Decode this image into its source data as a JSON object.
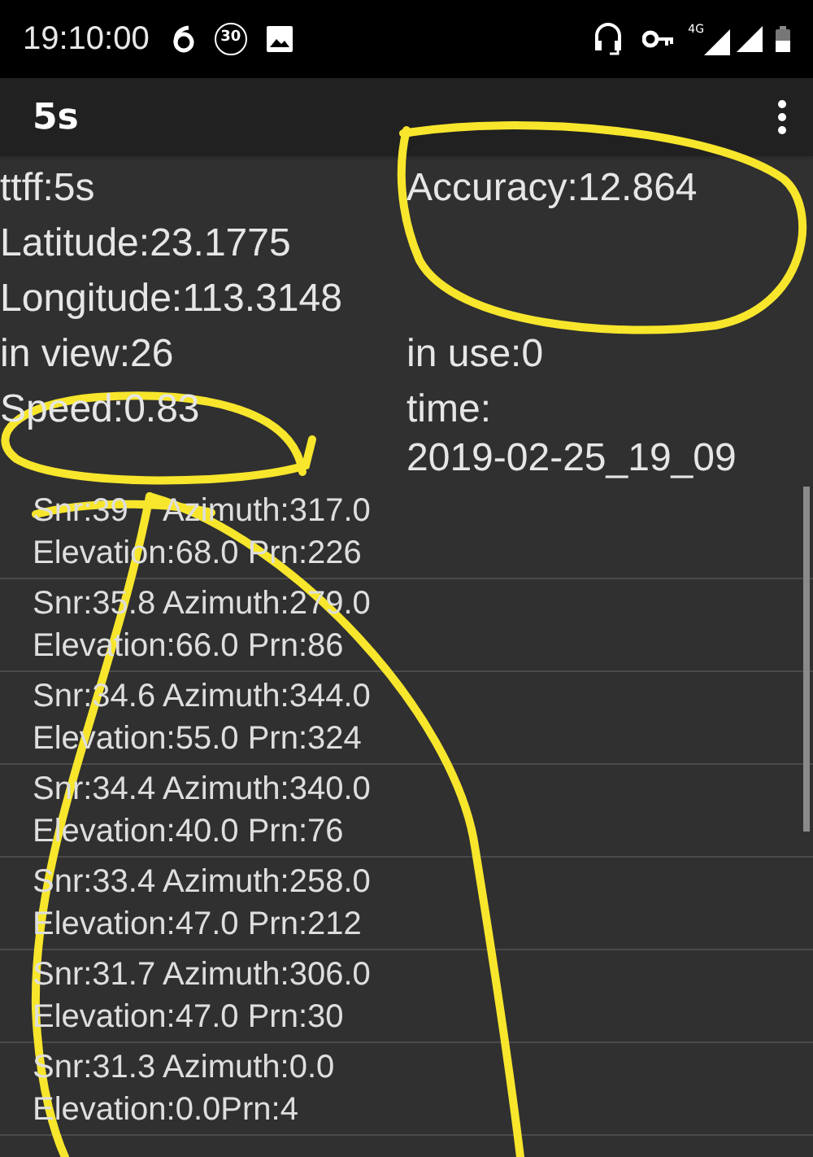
{
  "status_bar": {
    "time": "19:10:00",
    "badge": "30",
    "network": "4G"
  },
  "app_bar": {
    "title": "5s"
  },
  "info": [
    {
      "left": "ttff:5s",
      "right": "Accuracy:12.864"
    },
    {
      "left": "Latitude:23.1775"
    },
    {
      "left": "Longitude:113.3148"
    },
    {
      "left": "in view:26",
      "right": "in use:0"
    },
    {
      "left": "Speed:0.83",
      "right": "time: 2019-02-25_19_09"
    }
  ],
  "satellites": [
    {
      "line_1": "Snr:39    Azimuth:317.0",
      "line_2": "Elevation:68.0 Prn:226"
    },
    {
      "line_1": "Snr:35.8 Azimuth:279.0",
      "line_2": "Elevation:66.0 Prn:86"
    },
    {
      "line_1": "Snr:34.6 Azimuth:344.0",
      "line_2": "Elevation:55.0 Prn:324"
    },
    {
      "line_1": "Snr:34.4 Azimuth:340.0",
      "line_2": "Elevation:40.0 Prn:76"
    },
    {
      "line_1": "Snr:33.4 Azimuth:258.0",
      "line_2": "Elevation:47.0 Prn:212"
    },
    {
      "line_1": "Snr:31.7 Azimuth:306.0",
      "line_2": "Elevation:47.0 Prn:30"
    },
    {
      "line_1": "Snr:31.3 Azimuth:0.0",
      "line_2": "Elevation:0.0Prn:4"
    }
  ]
}
